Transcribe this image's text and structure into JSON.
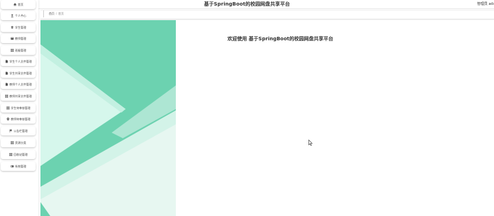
{
  "header": {
    "title": "基于SpringBoot的校园网盘共享平台",
    "admin_label": "管理员 adı"
  },
  "breadcrumb": {
    "home": "首页",
    "separator": "/",
    "current": "首页"
  },
  "sidebar": {
    "items": [
      {
        "label": "首页",
        "icon": "home-icon"
      },
      {
        "label": "个人中心",
        "icon": "user-icon"
      },
      {
        "label": "学生管理",
        "icon": "student-icon"
      },
      {
        "label": "教师管理",
        "icon": "teacher-icon"
      },
      {
        "label": "班级管理",
        "icon": "grid-icon"
      },
      {
        "label": "学生个人文件管理",
        "icon": "file-icon"
      },
      {
        "label": "学生共享文件管理",
        "icon": "file-icon"
      },
      {
        "label": "教师个人文件管理",
        "icon": "file-icon"
      },
      {
        "label": "教师共享文件管理",
        "icon": "grid-icon"
      },
      {
        "label": "学生待审核管理",
        "icon": "grid-icon"
      },
      {
        "label": "教师待审核管理",
        "icon": "pin-icon"
      },
      {
        "label": "公告栏管理",
        "icon": "flag-icon"
      },
      {
        "label": "资源分类",
        "icon": "grid-icon"
      },
      {
        "label": "回收站管理",
        "icon": "grid-icon"
      },
      {
        "label": "系统管理",
        "icon": "settings-icon"
      }
    ]
  },
  "main": {
    "welcome": "欢迎使用 基于SpringBoot的校园网盘共享平台"
  },
  "colors": {
    "banner_base": "#6cd2b0",
    "banner_light": "#d9f8ee",
    "banner_pale": "#eaf7f2"
  }
}
